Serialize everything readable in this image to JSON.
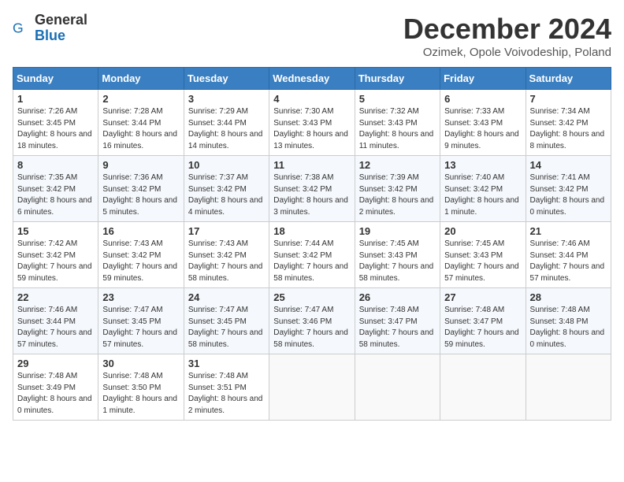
{
  "logo": {
    "general": "General",
    "blue": "Blue"
  },
  "title": "December 2024",
  "location": "Ozimek, Opole Voivodeship, Poland",
  "weekdays": [
    "Sunday",
    "Monday",
    "Tuesday",
    "Wednesday",
    "Thursday",
    "Friday",
    "Saturday"
  ],
  "weeks": [
    [
      {
        "day": "1",
        "sunrise": "Sunrise: 7:26 AM",
        "sunset": "Sunset: 3:45 PM",
        "daylight": "Daylight: 8 hours and 18 minutes."
      },
      {
        "day": "2",
        "sunrise": "Sunrise: 7:28 AM",
        "sunset": "Sunset: 3:44 PM",
        "daylight": "Daylight: 8 hours and 16 minutes."
      },
      {
        "day": "3",
        "sunrise": "Sunrise: 7:29 AM",
        "sunset": "Sunset: 3:44 PM",
        "daylight": "Daylight: 8 hours and 14 minutes."
      },
      {
        "day": "4",
        "sunrise": "Sunrise: 7:30 AM",
        "sunset": "Sunset: 3:43 PM",
        "daylight": "Daylight: 8 hours and 13 minutes."
      },
      {
        "day": "5",
        "sunrise": "Sunrise: 7:32 AM",
        "sunset": "Sunset: 3:43 PM",
        "daylight": "Daylight: 8 hours and 11 minutes."
      },
      {
        "day": "6",
        "sunrise": "Sunrise: 7:33 AM",
        "sunset": "Sunset: 3:43 PM",
        "daylight": "Daylight: 8 hours and 9 minutes."
      },
      {
        "day": "7",
        "sunrise": "Sunrise: 7:34 AM",
        "sunset": "Sunset: 3:42 PM",
        "daylight": "Daylight: 8 hours and 8 minutes."
      }
    ],
    [
      {
        "day": "8",
        "sunrise": "Sunrise: 7:35 AM",
        "sunset": "Sunset: 3:42 PM",
        "daylight": "Daylight: 8 hours and 6 minutes."
      },
      {
        "day": "9",
        "sunrise": "Sunrise: 7:36 AM",
        "sunset": "Sunset: 3:42 PM",
        "daylight": "Daylight: 8 hours and 5 minutes."
      },
      {
        "day": "10",
        "sunrise": "Sunrise: 7:37 AM",
        "sunset": "Sunset: 3:42 PM",
        "daylight": "Daylight: 8 hours and 4 minutes."
      },
      {
        "day": "11",
        "sunrise": "Sunrise: 7:38 AM",
        "sunset": "Sunset: 3:42 PM",
        "daylight": "Daylight: 8 hours and 3 minutes."
      },
      {
        "day": "12",
        "sunrise": "Sunrise: 7:39 AM",
        "sunset": "Sunset: 3:42 PM",
        "daylight": "Daylight: 8 hours and 2 minutes."
      },
      {
        "day": "13",
        "sunrise": "Sunrise: 7:40 AM",
        "sunset": "Sunset: 3:42 PM",
        "daylight": "Daylight: 8 hours and 1 minute."
      },
      {
        "day": "14",
        "sunrise": "Sunrise: 7:41 AM",
        "sunset": "Sunset: 3:42 PM",
        "daylight": "Daylight: 8 hours and 0 minutes."
      }
    ],
    [
      {
        "day": "15",
        "sunrise": "Sunrise: 7:42 AM",
        "sunset": "Sunset: 3:42 PM",
        "daylight": "Daylight: 7 hours and 59 minutes."
      },
      {
        "day": "16",
        "sunrise": "Sunrise: 7:43 AM",
        "sunset": "Sunset: 3:42 PM",
        "daylight": "Daylight: 7 hours and 59 minutes."
      },
      {
        "day": "17",
        "sunrise": "Sunrise: 7:43 AM",
        "sunset": "Sunset: 3:42 PM",
        "daylight": "Daylight: 7 hours and 58 minutes."
      },
      {
        "day": "18",
        "sunrise": "Sunrise: 7:44 AM",
        "sunset": "Sunset: 3:42 PM",
        "daylight": "Daylight: 7 hours and 58 minutes."
      },
      {
        "day": "19",
        "sunrise": "Sunrise: 7:45 AM",
        "sunset": "Sunset: 3:43 PM",
        "daylight": "Daylight: 7 hours and 58 minutes."
      },
      {
        "day": "20",
        "sunrise": "Sunrise: 7:45 AM",
        "sunset": "Sunset: 3:43 PM",
        "daylight": "Daylight: 7 hours and 57 minutes."
      },
      {
        "day": "21",
        "sunrise": "Sunrise: 7:46 AM",
        "sunset": "Sunset: 3:44 PM",
        "daylight": "Daylight: 7 hours and 57 minutes."
      }
    ],
    [
      {
        "day": "22",
        "sunrise": "Sunrise: 7:46 AM",
        "sunset": "Sunset: 3:44 PM",
        "daylight": "Daylight: 7 hours and 57 minutes."
      },
      {
        "day": "23",
        "sunrise": "Sunrise: 7:47 AM",
        "sunset": "Sunset: 3:45 PM",
        "daylight": "Daylight: 7 hours and 57 minutes."
      },
      {
        "day": "24",
        "sunrise": "Sunrise: 7:47 AM",
        "sunset": "Sunset: 3:45 PM",
        "daylight": "Daylight: 7 hours and 58 minutes."
      },
      {
        "day": "25",
        "sunrise": "Sunrise: 7:47 AM",
        "sunset": "Sunset: 3:46 PM",
        "daylight": "Daylight: 7 hours and 58 minutes."
      },
      {
        "day": "26",
        "sunrise": "Sunrise: 7:48 AM",
        "sunset": "Sunset: 3:47 PM",
        "daylight": "Daylight: 7 hours and 58 minutes."
      },
      {
        "day": "27",
        "sunrise": "Sunrise: 7:48 AM",
        "sunset": "Sunset: 3:47 PM",
        "daylight": "Daylight: 7 hours and 59 minutes."
      },
      {
        "day": "28",
        "sunrise": "Sunrise: 7:48 AM",
        "sunset": "Sunset: 3:48 PM",
        "daylight": "Daylight: 8 hours and 0 minutes."
      }
    ],
    [
      {
        "day": "29",
        "sunrise": "Sunrise: 7:48 AM",
        "sunset": "Sunset: 3:49 PM",
        "daylight": "Daylight: 8 hours and 0 minutes."
      },
      {
        "day": "30",
        "sunrise": "Sunrise: 7:48 AM",
        "sunset": "Sunset: 3:50 PM",
        "daylight": "Daylight: 8 hours and 1 minute."
      },
      {
        "day": "31",
        "sunrise": "Sunrise: 7:48 AM",
        "sunset": "Sunset: 3:51 PM",
        "daylight": "Daylight: 8 hours and 2 minutes."
      },
      null,
      null,
      null,
      null
    ]
  ]
}
